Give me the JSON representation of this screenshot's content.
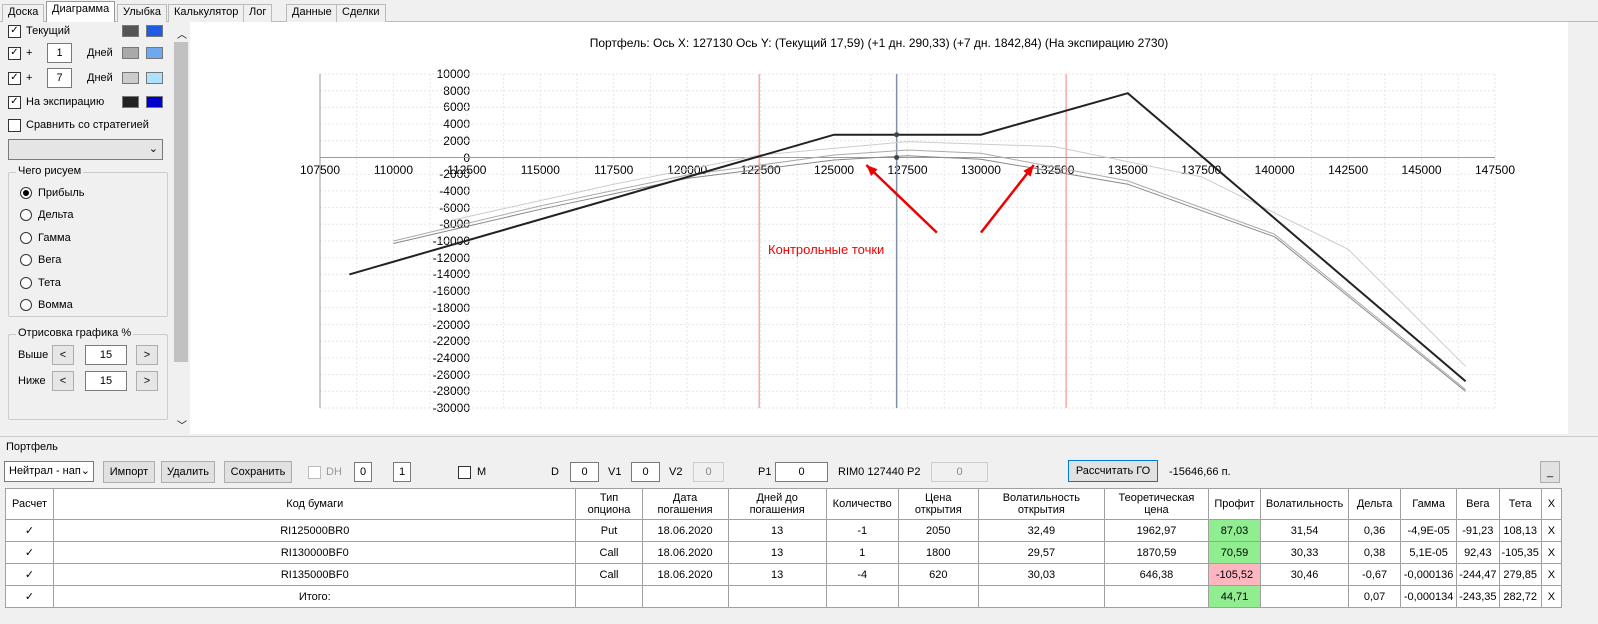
{
  "tabs": [
    "Доска",
    "Диаграмма",
    "Улыбка",
    "Калькулятор",
    "Лог",
    "Данные",
    "Сделки"
  ],
  "active_tab": "Диаграмма",
  "left": {
    "current_label": "Текущий",
    "plus1": "+",
    "days1": "1",
    "days_label": "Дней",
    "plus2": "+",
    "days2": "7",
    "expiry_label": "На экспирацию",
    "compare_label": "Сравнить со стратегией",
    "what_group": "Чего рисуем",
    "radios": [
      "Прибыль",
      "Дельта",
      "Гамма",
      "Вега",
      "Тета",
      "Вомма"
    ],
    "draw_group": "Отрисовка графика %",
    "above_label": "Выше",
    "above_value": "15",
    "below_label": "Ниже",
    "below_value": "15",
    "prev": "<",
    "next": ">",
    "colors": {
      "current": [
        "#555555",
        "#1e5ce6"
      ],
      "d1": [
        "#a9a9a9",
        "#6ea8f0"
      ],
      "d7": [
        "#cccccc",
        "#aee0ff"
      ],
      "expiry": [
        "#222222",
        "#0000cc"
      ]
    }
  },
  "chart_data": {
    "type": "line",
    "title": "Портфель: Ось X: 127130 Ось Y:  (Текущий 17,59)  (+1 дн. 290,33)  (+7 дн. 1842,84)  (На экспирацию 2730)",
    "x_ticks": [
      "107500",
      "110000",
      "112500",
      "115000",
      "117500",
      "120000",
      "122500",
      "125000",
      "127500",
      "130000",
      "132500",
      "135000",
      "137500",
      "140000",
      "142500",
      "145000",
      "147500"
    ],
    "y_ticks": [
      "10000",
      "8000",
      "6000",
      "4000",
      "2000",
      "0",
      "-2000",
      "-4000",
      "-6000",
      "-8000",
      "-10000",
      "-12000",
      "-14000",
      "-16000",
      "-18000",
      "-20000",
      "-22000",
      "-24000",
      "-26000",
      "-28000",
      "-30000"
    ],
    "xlim": [
      107500,
      147500
    ],
    "ylim": [
      -30000,
      10000
    ],
    "cursor_x": 127130,
    "range_lines": [
      122450,
      132900
    ],
    "annotation": "Контрольные точки",
    "series": [
      {
        "color": "#222222",
        "width": 2,
        "points": [
          [
            108500,
            -14000
          ],
          [
            125000,
            2730
          ],
          [
            130000,
            2730
          ],
          [
            135000,
            7700
          ],
          [
            146500,
            -26800
          ]
        ]
      },
      {
        "color": "#888888",
        "width": 1,
        "points": [
          [
            110000,
            -10300
          ],
          [
            115000,
            -6200
          ],
          [
            120000,
            -2500
          ],
          [
            125000,
            -300
          ],
          [
            127500,
            200
          ],
          [
            130000,
            -200
          ],
          [
            135000,
            -3200
          ],
          [
            140000,
            -9500
          ],
          [
            146500,
            -28000
          ]
        ]
      },
      {
        "color": "#aaaaaa",
        "width": 1,
        "points": [
          [
            110000,
            -10000
          ],
          [
            115000,
            -5800
          ],
          [
            120000,
            -2100
          ],
          [
            125000,
            300
          ],
          [
            127500,
            900
          ],
          [
            130000,
            500
          ],
          [
            135000,
            -2800
          ],
          [
            140000,
            -9200
          ],
          [
            146500,
            -27800
          ]
        ]
      },
      {
        "color": "#cccccc",
        "width": 1,
        "points": [
          [
            112000,
            -7500
          ],
          [
            117500,
            -3200
          ],
          [
            122500,
            300
          ],
          [
            127500,
            1900
          ],
          [
            132500,
            1300
          ],
          [
            137500,
            -2300
          ],
          [
            142500,
            -11000
          ],
          [
            146500,
            -25000
          ]
        ]
      }
    ],
    "dots": [
      [
        127130,
        2730
      ],
      [
        127130,
        0
      ]
    ],
    "arrows": [
      [
        [
          130000,
          -9000
        ],
        [
          131800,
          -900
        ]
      ],
      [
        [
          128500,
          -9000
        ],
        [
          126100,
          -900
        ]
      ]
    ]
  },
  "bottom": {
    "portfolio_label": "Портфель",
    "dropdown": "Нейтрал - нап",
    "import": "Импорт",
    "delete": "Удалить",
    "save": "Сохранить",
    "dh": "DH",
    "dh1": "0",
    "dh2": "1",
    "m": "M",
    "d_label": "D",
    "d_value": "0",
    "v1_label": "V1",
    "v1_value": "0",
    "v2_label": "V2",
    "v2_value": "0",
    "p1_label": "P1",
    "p1_value": "0",
    "rim": "RIM0 127440",
    "p2_label": "P2",
    "p2_value": "0",
    "calc_go": "Рассчитать ГО",
    "go_value": "-15646,66 п.",
    "min": "_"
  },
  "table": {
    "headers": [
      "Расчет",
      "Код бумаги",
      "Тип опциона",
      "Дата погашения",
      "Дней до погашения",
      "Количество",
      "Цена открытия",
      "Волатильность открытия",
      "Теоретическая цена",
      "Профит",
      "Волатильность",
      "Дельта",
      "Гамма",
      "Вега",
      "Тета",
      "X"
    ],
    "rows": [
      [
        "✓",
        "RI125000BR0",
        "Put",
        "18.06.2020",
        "13",
        "-1",
        "2050",
        "32,49",
        "1962,97",
        "87,03",
        "31,54",
        "0,36",
        "-4,9E-05",
        "-91,23",
        "108,13",
        "X"
      ],
      [
        "✓",
        "RI130000BF0",
        "Call",
        "18.06.2020",
        "13",
        "1",
        "1800",
        "29,57",
        "1870,59",
        "70,59",
        "30,33",
        "0,38",
        "5,1E-05",
        "92,43",
        "-105,35",
        "X"
      ],
      [
        "✓",
        "RI135000BF0",
        "Call",
        "18.06.2020",
        "13",
        "-4",
        "620",
        "30,03",
        "646,38",
        "-105,52",
        "30,46",
        "-0,67",
        "-0,000136",
        "-244,47",
        "279,85",
        "X"
      ],
      [
        "✓",
        "Итого:",
        "",
        "",
        "",
        "",
        "",
        "",
        "",
        "44,71",
        "",
        "0,07",
        "-0,000134",
        "-243,35",
        "282,72",
        "X"
      ]
    ]
  }
}
